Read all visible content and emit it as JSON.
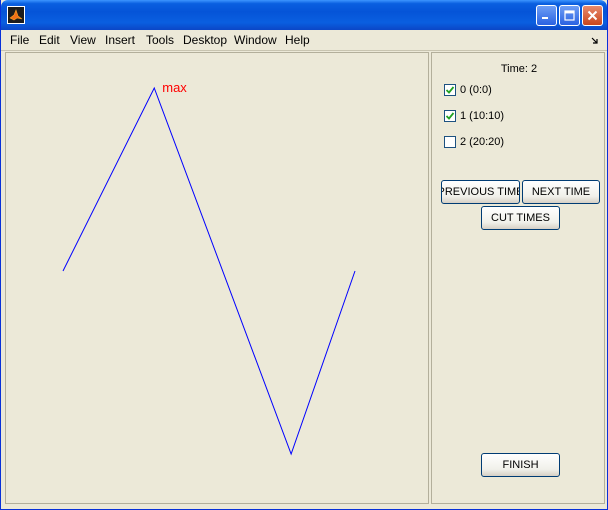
{
  "menu": {
    "items": [
      {
        "label": "File"
      },
      {
        "label": "Edit"
      },
      {
        "label": "View"
      },
      {
        "label": "Insert"
      },
      {
        "label": "Tools"
      },
      {
        "label": "Desktop"
      },
      {
        "label": "Window"
      },
      {
        "label": "Help"
      }
    ]
  },
  "plot": {
    "annotation": "max",
    "line_color": "#0000ff",
    "annotation_color": "#ff0000",
    "points": [
      [
        0,
        0
      ],
      [
        1,
        1
      ],
      [
        2.5,
        -1
      ],
      [
        3.2,
        0
      ]
    ]
  },
  "controls": {
    "time_label": "Time: 2",
    "checkboxes": [
      {
        "label": "0 (0:0)",
        "checked": true
      },
      {
        "label": "1 (10:10)",
        "checked": true
      },
      {
        "label": "2 (20:20)",
        "checked": false
      }
    ],
    "prev_label": "PREVIOUS TIME",
    "next_label": "NEXT TIME",
    "cut_label": "CUT TIMES",
    "finish_label": "FINISH"
  }
}
